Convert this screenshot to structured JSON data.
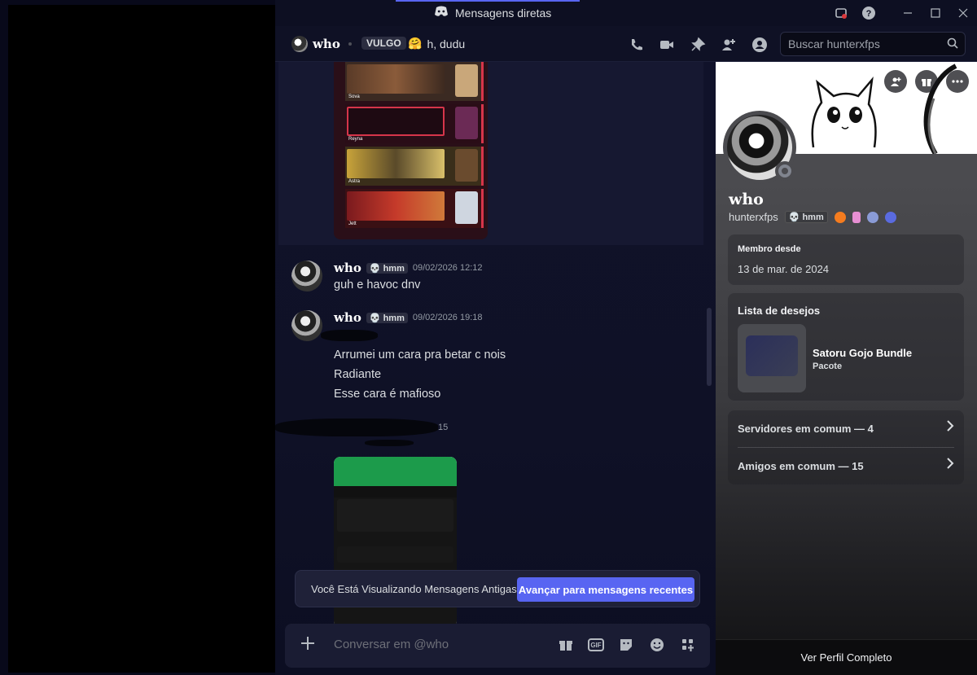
{
  "window": {
    "title": "Mensagens diretas"
  },
  "header": {
    "username": "who",
    "tag": "VULGO",
    "status_emoji": "🤗",
    "status_text": "h, dudu",
    "search_placeholder": "Buscar hunterxfps"
  },
  "image_valorant": {
    "rows": [
      {
        "label": "Sova",
        "color": "#b36b3e"
      },
      {
        "label": "Reyna",
        "color": "#8a2038"
      },
      {
        "label": "Astra",
        "color": "#c8a33a"
      },
      {
        "label": "Jett",
        "color": "#a8242a"
      }
    ]
  },
  "messages": [
    {
      "author": "who",
      "badge": "💀 hmm",
      "time": "09/02/2026 12:12",
      "lines": [
        "guh e havoc dnv"
      ]
    },
    {
      "author": "who",
      "badge": "💀 hmm",
      "time": "09/02/2026 19:18",
      "lines": [
        "Arrumei um cara pra betar c nois",
        "Radiante",
        "Esse cara é mafioso"
      ]
    },
    {
      "time_fragment": "15"
    }
  ],
  "toast": {
    "text": "Você Está Visualizando Mensagens Antigas",
    "button": "Avançar para mensagens recentes"
  },
  "composer": {
    "placeholder": "Conversar em @who",
    "gif_label": "GIF"
  },
  "profile": {
    "display_name": "who",
    "handle": "hunterxfps",
    "badge": "💀 hmm",
    "member_since_label": "Membro desde",
    "member_since": "13 de mar. de 2024",
    "wishlist_label": "Lista de desejos",
    "wish_item": "Satoru Gojo Bundle",
    "wish_type": "Pacote",
    "mutual_servers": "Servidores em comum — 4",
    "mutual_friends": "Amigos em comum — 15",
    "full_profile": "Ver Perfil Completo"
  },
  "colors": {
    "accent": "#5865f2",
    "chat_bg": "#10122a",
    "panel_bg": "#4b4b4f"
  }
}
